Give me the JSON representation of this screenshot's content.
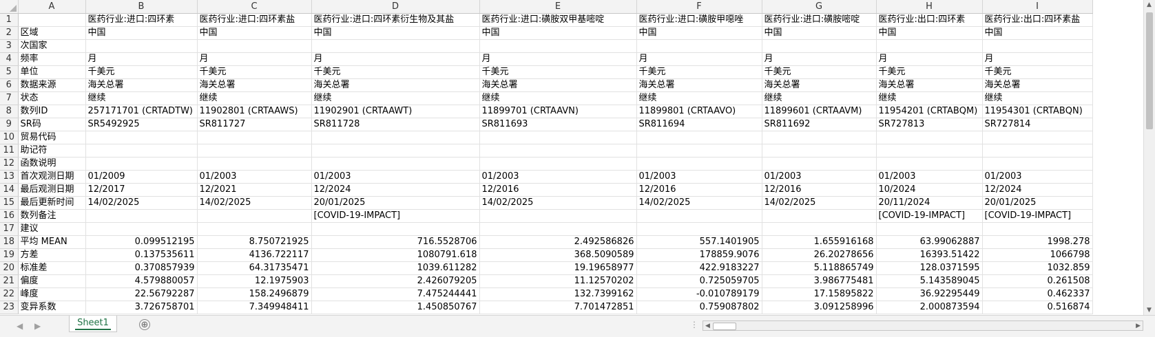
{
  "columns": [
    "A",
    "B",
    "C",
    "D",
    "E",
    "F",
    "G",
    "H",
    "I"
  ],
  "rows": [
    {
      "n": "1",
      "a": "",
      "c": [
        "医药行业:进口:四环素",
        "医药行业:进口:四环素盐",
        "医药行业:进口:四环素衍生物及其盐",
        "医药行业:进口:磺胺双甲基嘧啶",
        "医药行业:进口:磺胺甲噁唑",
        "医药行业:进口:磺胺嘧啶",
        "医药行业:出口:四环素",
        "医药行业:出口:四环素盐"
      ]
    },
    {
      "n": "2",
      "a": "区域",
      "c": [
        "中国",
        "中国",
        "中国",
        "中国",
        "中国",
        "中国",
        "中国",
        "中国"
      ]
    },
    {
      "n": "3",
      "a": "次国家",
      "c": [
        "",
        "",
        "",
        "",
        "",
        "",
        "",
        ""
      ]
    },
    {
      "n": "4",
      "a": "频率",
      "c": [
        "月",
        "月",
        "月",
        "月",
        "月",
        "月",
        "月",
        "月"
      ]
    },
    {
      "n": "5",
      "a": "单位",
      "c": [
        "千美元",
        "千美元",
        "千美元",
        "千美元",
        "千美元",
        "千美元",
        "千美元",
        "千美元"
      ]
    },
    {
      "n": "6",
      "a": "数据来源",
      "c": [
        "海关总署",
        "海关总署",
        "海关总署",
        "海关总署",
        "海关总署",
        "海关总署",
        "海关总署",
        "海关总署"
      ]
    },
    {
      "n": "7",
      "a": "状态",
      "c": [
        "继续",
        "继续",
        "继续",
        "继续",
        "继续",
        "继续",
        "继续",
        "继续"
      ]
    },
    {
      "n": "8",
      "a": "数列ID",
      "c": [
        "257171701 (CRTADTW)",
        "11902801 (CRTAAWS)",
        "11902901 (CRTAAWT)",
        "11899701 (CRTAAVN)",
        "11899801 (CRTAAVO)",
        "11899601 (CRTAAVM)",
        "11954201 (CRTABQM)",
        "11954301 (CRTABQN)"
      ]
    },
    {
      "n": "9",
      "a": "SR码",
      "c": [
        "SR5492925",
        "SR811727",
        "SR811728",
        "SR811693",
        "SR811694",
        "SR811692",
        "SR727813",
        "SR727814"
      ]
    },
    {
      "n": "10",
      "a": "贸易代码",
      "c": [
        "",
        "",
        "",
        "",
        "",
        "",
        "",
        ""
      ]
    },
    {
      "n": "11",
      "a": "助记符",
      "c": [
        "",
        "",
        "",
        "",
        "",
        "",
        "",
        ""
      ]
    },
    {
      "n": "12",
      "a": "函数说明",
      "c": [
        "",
        "",
        "",
        "",
        "",
        "",
        "",
        ""
      ]
    },
    {
      "n": "13",
      "a": "首次观测日期",
      "c": [
        "01/2009",
        "01/2003",
        "01/2003",
        "01/2003",
        "01/2003",
        "01/2003",
        "01/2003",
        "01/2003"
      ]
    },
    {
      "n": "14",
      "a": "最后观测日期",
      "c": [
        "12/2017",
        "12/2021",
        "12/2024",
        "12/2016",
        "12/2016",
        "12/2016",
        "10/2024",
        "12/2024"
      ]
    },
    {
      "n": "15",
      "a": "最后更新时间",
      "c": [
        "14/02/2025",
        "14/02/2025",
        "20/01/2025",
        "14/02/2025",
        "14/02/2025",
        "14/02/2025",
        "20/11/2024",
        "20/01/2025"
      ]
    },
    {
      "n": "16",
      "a": "数列备注",
      "c": [
        "",
        "",
        "[COVID-19-IMPACT]",
        "",
        "",
        "",
        "[COVID-19-IMPACT]",
        "[COVID-19-IMPACT]"
      ]
    },
    {
      "n": "17",
      "a": "建议",
      "c": [
        "",
        "",
        "",
        "",
        "",
        "",
        "",
        ""
      ]
    },
    {
      "n": "18",
      "a": "平均 MEAN",
      "num": true,
      "c": [
        "0.099512195",
        "8.750721925",
        "716.5528706",
        "2.492586826",
        "557.1401905",
        "1.655916168",
        "63.99062887",
        "1998.278"
      ]
    },
    {
      "n": "19",
      "a": "方差",
      "num": true,
      "c": [
        "0.137535611",
        "4136.722117",
        "1080791.618",
        "368.5090589",
        "178859.9076",
        "26.20278656",
        "16393.51422",
        "1066798"
      ]
    },
    {
      "n": "20",
      "a": "标准差",
      "num": true,
      "c": [
        "0.370857939",
        "64.31735471",
        "1039.611282",
        "19.19658977",
        "422.9183227",
        "5.118865749",
        "128.0371595",
        "1032.859"
      ]
    },
    {
      "n": "21",
      "a": "偏度",
      "num": true,
      "c": [
        "4.579880057",
        "12.1975903",
        "2.426079205",
        "11.12570202",
        "0.725059705",
        "3.986775481",
        "5.143589045",
        "0.261508"
      ]
    },
    {
      "n": "22",
      "a": "峰度",
      "num": true,
      "c": [
        "22.56792287",
        "158.2496879",
        "7.475244441",
        "132.7399162",
        "-0.010789179",
        "17.15895822",
        "36.92295449",
        "0.462337"
      ]
    },
    {
      "n": "23",
      "a": "变异系数",
      "num": true,
      "c": [
        "3.726758701",
        "7.349948411",
        "1.450850767",
        "7.701472851",
        "0.759087802",
        "3.091258996",
        "2.000873594",
        "0.516874"
      ]
    }
  ],
  "sheet_tab": "Sheet1",
  "add_sheet_symbol": "⊕",
  "icons": {
    "corner": "select-all-icon",
    "add": "add-sheet-icon"
  }
}
